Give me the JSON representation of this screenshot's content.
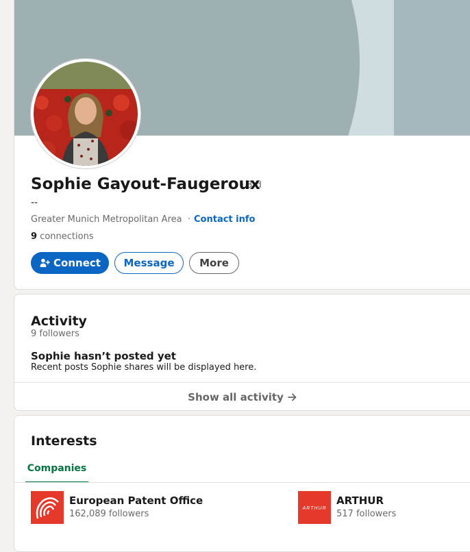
{
  "profile": {
    "name": "Sophie Gayout-Faugeroux",
    "degree": "· 3rd",
    "headline": "--",
    "location": "Greater Munich Metropolitan Area",
    "separator": "·",
    "contact_info_label": "Contact info",
    "connections_count": "9",
    "connections_label": "connections",
    "buttons": {
      "connect": "Connect",
      "message": "Message",
      "more": "More"
    }
  },
  "activity": {
    "title": "Activity",
    "followers": "9 followers",
    "empty_title": "Sophie hasn’t posted yet",
    "empty_subtitle": "Recent posts Sophie shares will be displayed here.",
    "show_all_label": "Show all activity"
  },
  "interests": {
    "title": "Interests",
    "tabs": [
      {
        "label": "Companies",
        "active": true
      }
    ],
    "companies": [
      {
        "name": "European Patent Office",
        "followers": "162,089 followers",
        "logo_color": "#e4392b"
      },
      {
        "name": "ARTHUR",
        "followers": "517 followers",
        "logo_color": "#e4392b",
        "logo_text": "ARTHUR"
      }
    ]
  },
  "colors": {
    "accent": "#0a66c2",
    "tab_active": "#057642",
    "banner_light": "#cfdde0",
    "banner_dark": "#9fb0b3"
  }
}
